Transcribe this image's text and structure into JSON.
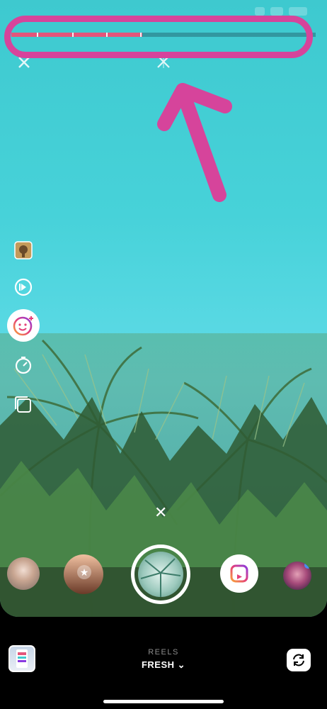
{
  "camera": {
    "recording_progress": 0.43,
    "segments_recorded": 4,
    "close_glyph": "✕"
  },
  "annotation": {
    "color": "#d6449b",
    "shape": "rounded-rectangle-with-arrow"
  },
  "side_tools": [
    {
      "icon": "audio-clip-thumbnail-icon"
    },
    {
      "icon": "speed-icon"
    },
    {
      "icon": "effects-face-icon"
    },
    {
      "icon": "timer-icon"
    },
    {
      "icon": "layout-icon"
    }
  ],
  "effects_tray": [
    {
      "icon": "effect-avatar-1"
    },
    {
      "icon": "effect-star-icon",
      "glyph": "★"
    },
    {
      "icon": "shutter-button"
    },
    {
      "icon": "reels-icon"
    },
    {
      "icon": "effect-avatar-2"
    }
  ],
  "bottom": {
    "mode_label": "REELS",
    "filter_label": "FRESH",
    "chevron": "⌄"
  },
  "colors": {
    "accent": "#e4557b",
    "sky": "#47d2d9",
    "annotation": "#d6449b"
  }
}
